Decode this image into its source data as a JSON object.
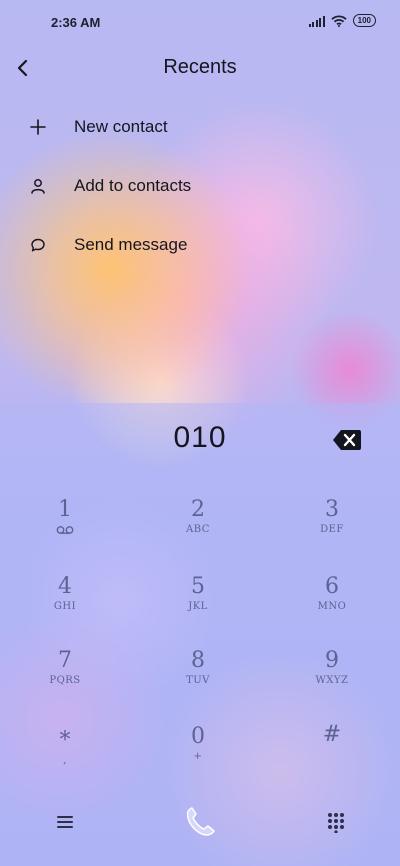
{
  "status": {
    "time": "2:36 AM",
    "battery": "100"
  },
  "header": {
    "title": "Recents"
  },
  "actions": [
    {
      "label": "New contact",
      "icon": "plus-icon"
    },
    {
      "label": "Add to contacts",
      "icon": "person-icon"
    },
    {
      "label": "Send message",
      "icon": "message-icon"
    }
  ],
  "dialer": {
    "number": "010",
    "keys": [
      {
        "digit": "1",
        "letters": ""
      },
      {
        "digit": "2",
        "letters": "ABC"
      },
      {
        "digit": "3",
        "letters": "DEF"
      },
      {
        "digit": "4",
        "letters": "GHI"
      },
      {
        "digit": "5",
        "letters": "JKL"
      },
      {
        "digit": "6",
        "letters": "MNO"
      },
      {
        "digit": "7",
        "letters": "PQRS"
      },
      {
        "digit": "8",
        "letters": "TUV"
      },
      {
        "digit": "9",
        "letters": "WXYZ"
      },
      {
        "digit": "*",
        "letters": ","
      },
      {
        "digit": "0",
        "letters": "+"
      },
      {
        "digit": "#",
        "letters": ""
      }
    ]
  },
  "colors": {
    "text": "#15151f",
    "keypad": "#5d6292",
    "accent_call": "#c9c9ff"
  }
}
